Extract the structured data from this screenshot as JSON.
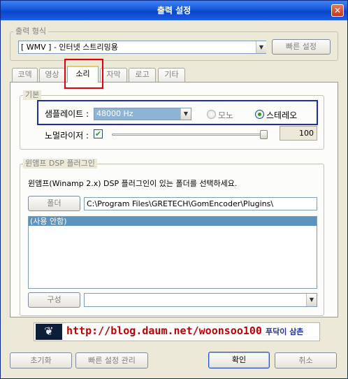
{
  "window": {
    "title": "출력 설정",
    "close_glyph": "✕"
  },
  "output_format": {
    "group_label": "출력 형식",
    "combo_value": "[ WMV ] - 인터넷 스트리밍용",
    "quick_settings_button": "빠른 설정"
  },
  "tabs": [
    {
      "label": "코덱",
      "active": false
    },
    {
      "label": "영상",
      "active": false
    },
    {
      "label": "소리",
      "active": true
    },
    {
      "label": "자막",
      "active": false
    },
    {
      "label": "로고",
      "active": false
    },
    {
      "label": "기타",
      "active": false
    }
  ],
  "basic": {
    "group_label": "기본",
    "samplerate_label": "샘플레이트 :",
    "samplerate_value": "48000 Hz",
    "mono_label": "모노",
    "stereo_label": "스테레오",
    "selected_channel": "stereo",
    "normalizer_label": "노멀라이저 :",
    "normalizer_checked": true,
    "normalizer_value": "100"
  },
  "dsp": {
    "group_label": "윈앰프 DSP 플러그인",
    "description": "윈앰프(Winamp 2.x) DSP 플러그인이 있는 폴더를 선택하세요.",
    "folder_button": "폴더",
    "folder_path": "C:\\Program Files\\GRETECH\\GomEncoder\\Plugins\\",
    "plugins": [
      "(사용 안함)"
    ],
    "config_button": "구성",
    "config_value": ""
  },
  "banner": {
    "url": "http://blog.daum.net/woonsoo100",
    "author": "푸닥이 삼촌",
    "url_color": "#c00000",
    "author_color": "#1f2f9f"
  },
  "footer": {
    "reset_button": "초기화",
    "manage_quick_button": "빠른 설정 관리",
    "ok_button": "확인",
    "cancel_button": "취소"
  }
}
